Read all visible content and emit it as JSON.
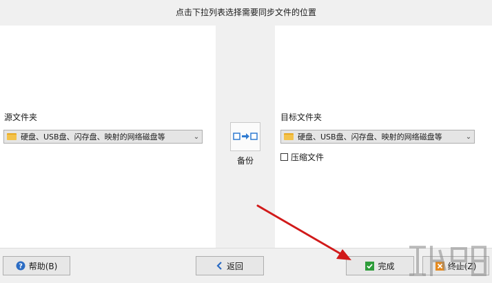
{
  "header": {
    "title": "点击下拉列表选择需要同步文件的位置"
  },
  "source": {
    "label": "源文件夹",
    "selected": "硬盘、USB盘、闪存盘、映射的网络磁盘等"
  },
  "middle": {
    "backup_label": "备份"
  },
  "target": {
    "label": "目标文件夹",
    "selected": "硬盘、USB盘、闪存盘、映射的网络磁盘等",
    "compress_label": "压缩文件",
    "compress_checked": false
  },
  "footer": {
    "help_label": "帮助(B)",
    "back_label": "返回",
    "finish_label": "完成",
    "stop_label": "终止(Z)"
  },
  "colors": {
    "arrow": "#d11a1a",
    "help_icon": "#2b6cc4",
    "back_icon": "#2b6cc4",
    "finish_icon": "#2e9c3a",
    "stop_icon": "#e58a1f"
  }
}
